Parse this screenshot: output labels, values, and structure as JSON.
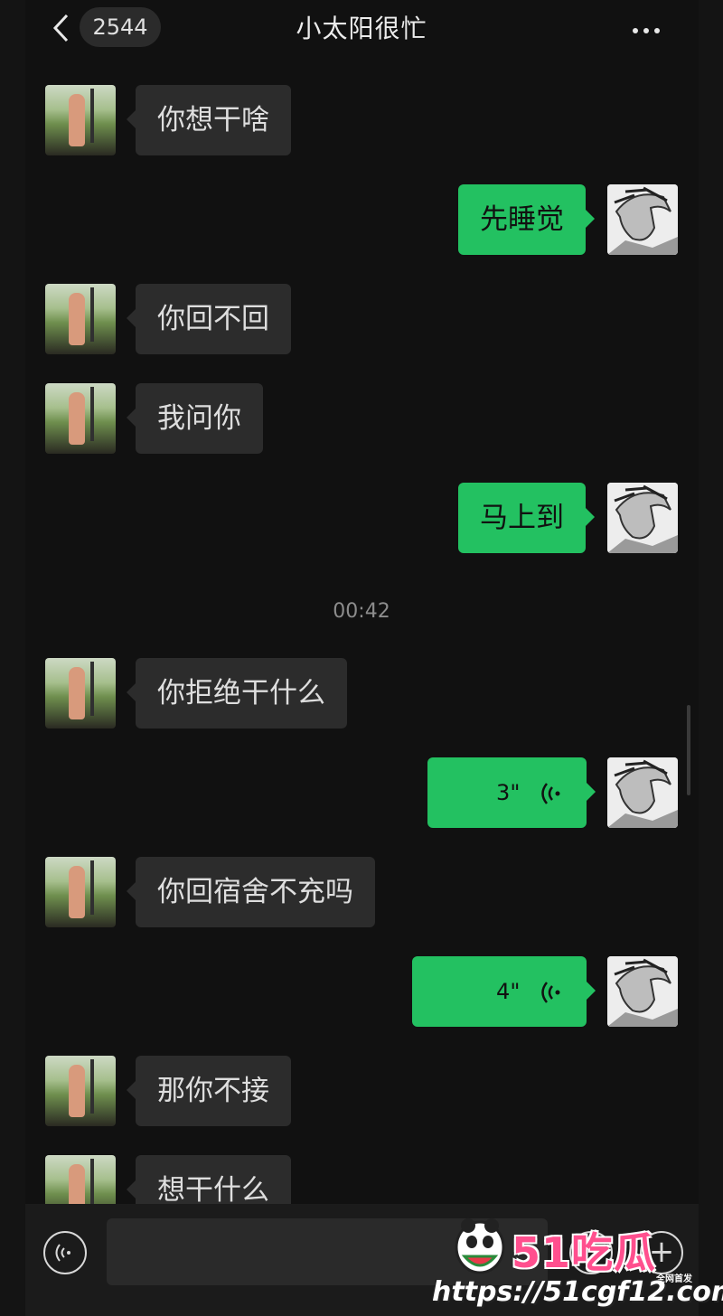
{
  "header": {
    "unread_count": "2544",
    "title": "小太阳很忙"
  },
  "messages": [
    {
      "side": "in",
      "text": "你想干啥"
    },
    {
      "side": "out",
      "text": "先睡觉"
    },
    {
      "side": "in",
      "text": "你回不回"
    },
    {
      "side": "in",
      "text": "我问你"
    },
    {
      "side": "out",
      "text": "马上到"
    },
    {
      "side": "in",
      "text": "你拒绝干什么"
    },
    {
      "side": "out",
      "type": "voice",
      "duration": "3\""
    },
    {
      "side": "in",
      "text": "你回宿舍不充吗"
    },
    {
      "side": "out",
      "type": "voice",
      "duration": "4\""
    },
    {
      "side": "in",
      "text": "那你不接"
    },
    {
      "side": "in",
      "text": "想干什么"
    }
  ],
  "timestamp": "00:42",
  "watermark": {
    "brand": "51吃瓜",
    "tag": "全网首发",
    "url": "https://51cgf12.com"
  },
  "colors": {
    "outgoing_bubble": "#23c161",
    "incoming_bubble": "#2c2c2c",
    "background": "#111111"
  }
}
